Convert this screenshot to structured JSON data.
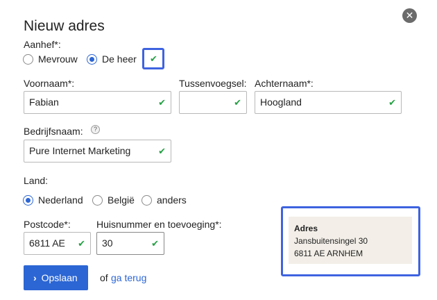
{
  "dialog": {
    "title": "Nieuw adres",
    "close_label": "✕"
  },
  "aanhef": {
    "label": "Aanhef*:",
    "options": [
      "Mevrouw",
      "De heer"
    ],
    "selected": "De heer"
  },
  "fields": {
    "voornaam": {
      "label": "Voornaam*:",
      "value": "Fabian"
    },
    "tussenvoegsel": {
      "label": "Tussenvoegsel:",
      "value": ""
    },
    "achternaam": {
      "label": "Achternaam*:",
      "value": "Hoogland"
    },
    "bedrijfsnaam": {
      "label": "Bedrijfsnaam:",
      "value": "Pure Internet Marketing",
      "help": "?"
    },
    "postcode": {
      "label": "Postcode*:",
      "value": "6811 AE"
    },
    "huisnummer": {
      "label": "Huisnummer en toevoeging*:",
      "value": "30"
    }
  },
  "land": {
    "label": "Land:",
    "options": [
      "Nederland",
      "België",
      "anders"
    ],
    "selected": "Nederland"
  },
  "validation": {
    "check_mark": "✔",
    "color": "#23a043"
  },
  "actions": {
    "save_chevron": "›",
    "save_label": "Opslaan",
    "or_text": "of",
    "back_label": "ga terug"
  },
  "preview": {
    "heading": "Adres",
    "line1": "Jansbuitensingel 30",
    "line2": "6811 AE ARNHEM"
  },
  "colors": {
    "accent": "#2c66d4",
    "highlight_border": "#3e63e0",
    "preview_bg": "#f3efe8"
  }
}
